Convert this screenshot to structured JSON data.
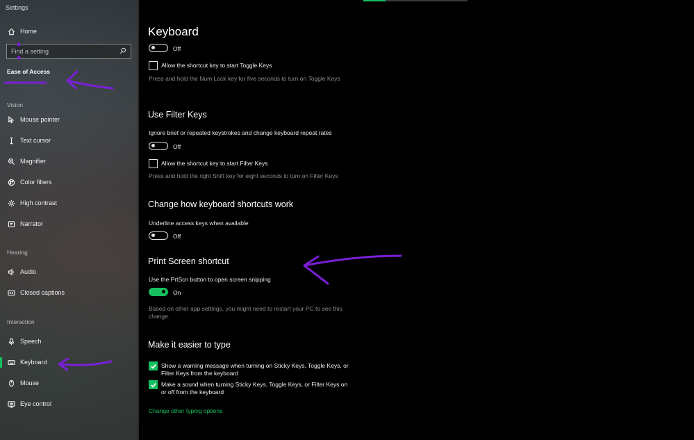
{
  "app": {
    "title": "Settings"
  },
  "sidebar": {
    "home_label": "Home",
    "search_placeholder": "Find a setting",
    "category": "Ease of Access",
    "sections": {
      "vision": "Vision",
      "hearing": "Hearing",
      "interaction": "Interaction"
    },
    "items": [
      {
        "label": "Mouse pointer",
        "icon": "mouse-pointer-icon"
      },
      {
        "label": "Text cursor",
        "icon": "text-cursor-icon"
      },
      {
        "label": "Magnifier",
        "icon": "magnifier-icon"
      },
      {
        "label": "Color filters",
        "icon": "color-filters-icon"
      },
      {
        "label": "High contrast",
        "icon": "high-contrast-icon"
      },
      {
        "label": "Narrator",
        "icon": "narrator-icon"
      },
      {
        "label": "Audio",
        "icon": "audio-icon"
      },
      {
        "label": "Closed captions",
        "icon": "closed-captions-icon"
      },
      {
        "label": "Speech",
        "icon": "microphone-icon"
      },
      {
        "label": "Keyboard",
        "icon": "keyboard-icon",
        "active": true
      },
      {
        "label": "Mouse",
        "icon": "mouse-icon"
      },
      {
        "label": "Eye control",
        "icon": "eye-control-icon"
      }
    ]
  },
  "main": {
    "title": "Keyboard",
    "toggle_keys": {
      "toggle_state": "Off",
      "shortcut_label": "Allow the shortcut key to start Toggle Keys",
      "hint": "Press and hold the Num Lock key for five seconds to turn on Toggle Keys"
    },
    "filter_keys": {
      "heading": "Use Filter Keys",
      "description": "Ignore brief or repeated keystrokes and change keyboard repeat rates",
      "toggle_state": "Off",
      "shortcut_label": "Allow the shortcut key to start Filter Keys",
      "hint": "Press and hold the right Shift key for eight seconds to turn on Filter Keys"
    },
    "shortcuts": {
      "heading": "Change how keyboard shortcuts work",
      "description": "Underline access keys when available",
      "toggle_state": "Off"
    },
    "print_screen": {
      "heading": "Print Screen shortcut",
      "description": "Use the PrtScn button to open screen snipping",
      "toggle_state": "On",
      "hint": "Based on other app settings, you might need to restart your PC to see this change."
    },
    "easier": {
      "heading": "Make it easier to type",
      "check1": "Show a warning message when turning on Sticky Keys, Toggle Keys, or Filter Keys from the keyboard",
      "check2": "Make a sound when turning Sticky Keys, Toggle Keys, or Filter Keys on or off from the keyboard"
    },
    "link": "Change other typing options"
  },
  "colors": {
    "accent": "#16c060",
    "annotation": "#7a1fd6"
  }
}
